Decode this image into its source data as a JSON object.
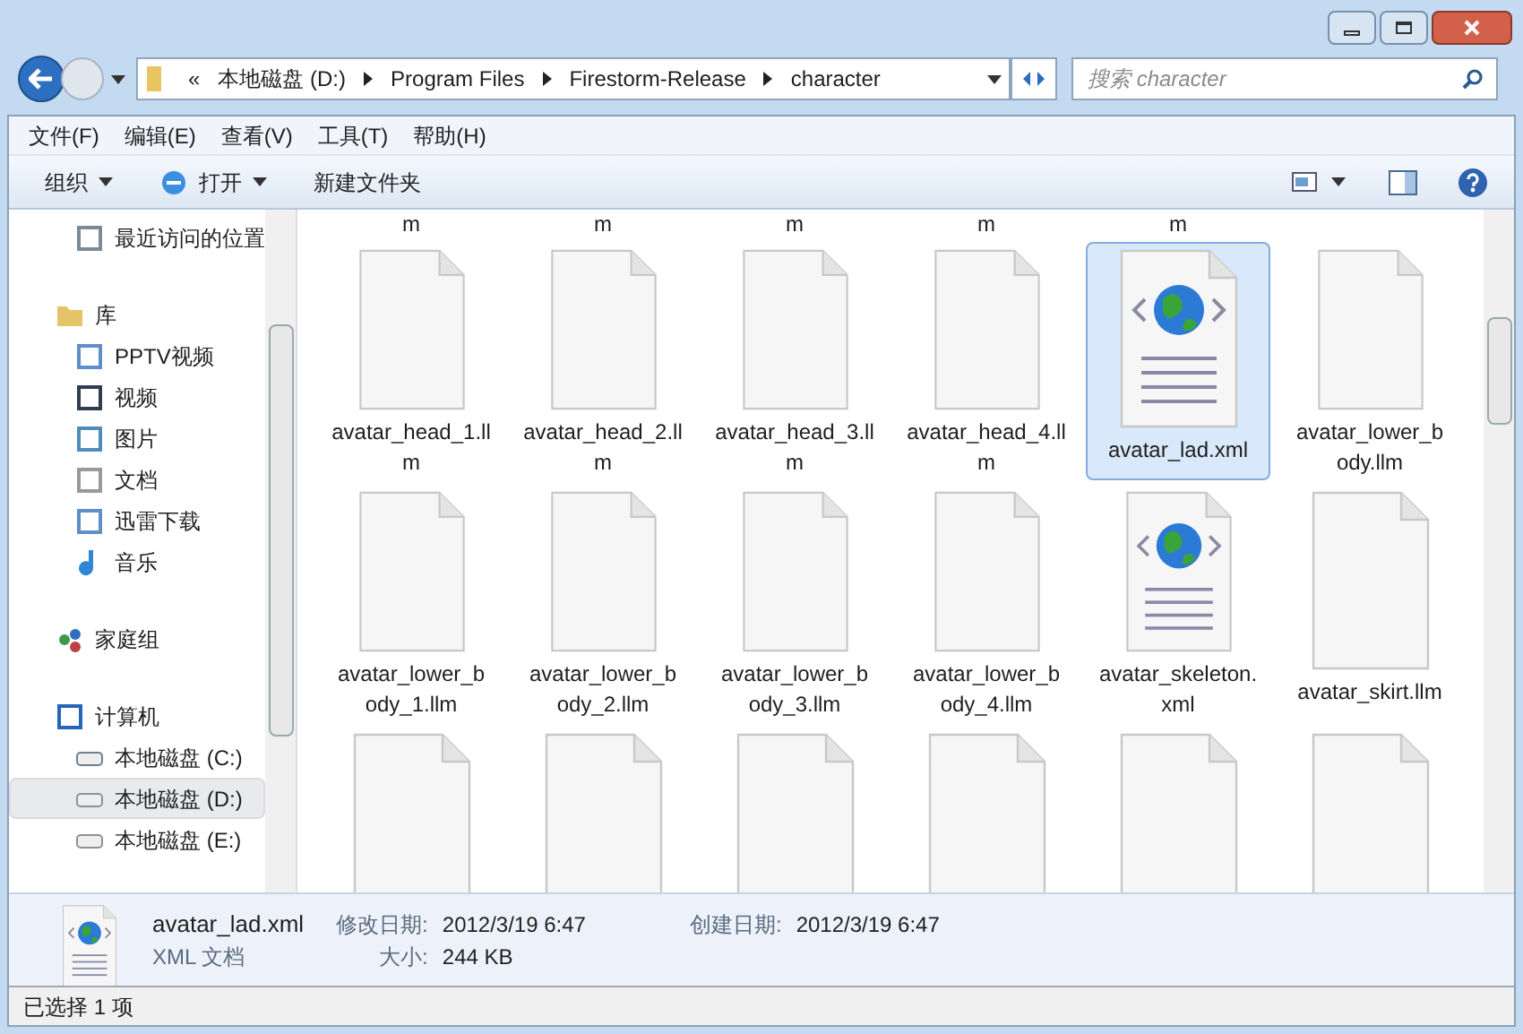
{
  "address": {
    "overflow": "«",
    "path": [
      "本地磁盘 (D:)",
      "Program Files",
      "Firestorm-Release",
      "character"
    ]
  },
  "search": {
    "placeholder": "搜索 character"
  },
  "menu": [
    "文件(F)",
    "编辑(E)",
    "查看(V)",
    "工具(T)",
    "帮助(H)"
  ],
  "toolbar": [
    {
      "label": "组织",
      "kind": "plain",
      "dropdown": true
    },
    {
      "label": "打开",
      "kind": "open",
      "dropdown": true
    },
    {
      "label": "新建文件夹",
      "kind": "plain",
      "dropdown": false
    }
  ],
  "nav": [
    {
      "children": [
        {
          "label": "最近访问的位置",
          "kind": "recent",
          "selected": false
        }
      ]
    },
    {
      "label": "库",
      "kind": "library",
      "selected": false,
      "children": [
        {
          "label": "PPTV视频",
          "kind": "doc",
          "selected": false
        },
        {
          "label": "视频",
          "kind": "video",
          "selected": false
        },
        {
          "label": "图片",
          "kind": "picture",
          "selected": false
        },
        {
          "label": "文档",
          "kind": "text",
          "selected": false
        },
        {
          "label": "迅雷下载",
          "kind": "doc",
          "selected": false
        },
        {
          "label": "音乐",
          "kind": "music",
          "selected": false
        }
      ]
    },
    {
      "label": "家庭组",
      "kind": "homegroup",
      "selected": false
    },
    {
      "label": "计算机",
      "kind": "computer",
      "selected": false,
      "children": [
        {
          "label": "本地磁盘 (C:)",
          "kind": "sysdrive",
          "selected": false
        },
        {
          "label": "本地磁盘 (D:)",
          "kind": "drive",
          "selected": true
        },
        {
          "label": "本地磁盘 (E:)",
          "kind": "drive",
          "selected": false
        }
      ]
    }
  ],
  "cut_row": [
    "m",
    "m",
    "m",
    "m",
    "m"
  ],
  "files": [
    {
      "kind": "generic",
      "lines": [
        "avatar_head_1.ll",
        "m"
      ],
      "selected": false
    },
    {
      "kind": "generic",
      "lines": [
        "avatar_head_2.ll",
        "m"
      ],
      "selected": false
    },
    {
      "kind": "generic",
      "lines": [
        "avatar_head_3.ll",
        "m"
      ],
      "selected": false
    },
    {
      "kind": "generic",
      "lines": [
        "avatar_head_4.ll",
        "m"
      ],
      "selected": false
    },
    {
      "kind": "xml",
      "lines": [
        "avatar_lad.xml"
      ],
      "selected": true
    },
    {
      "kind": "generic",
      "lines": [
        "avatar_lower_b",
        "ody.llm"
      ],
      "selected": false
    },
    {
      "kind": "generic",
      "lines": [
        "avatar_lower_b",
        "ody_1.llm"
      ],
      "selected": false
    },
    {
      "kind": "generic",
      "lines": [
        "avatar_lower_b",
        "ody_2.llm"
      ],
      "selected": false
    },
    {
      "kind": "generic",
      "lines": [
        "avatar_lower_b",
        "ody_3.llm"
      ],
      "selected": false
    },
    {
      "kind": "generic",
      "lines": [
        "avatar_lower_b",
        "ody_4.llm"
      ],
      "selected": false
    },
    {
      "kind": "xml",
      "lines": [
        "avatar_skeleton.",
        "xml"
      ],
      "selected": false
    },
    {
      "kind": "generic",
      "lines": [
        "avatar_skirt.llm"
      ],
      "selected": false
    },
    {
      "kind": "generic",
      "selected": false
    },
    {
      "kind": "generic",
      "selected": false
    },
    {
      "kind": "generic",
      "selected": false
    },
    {
      "kind": "generic",
      "selected": false
    },
    {
      "kind": "generic",
      "selected": false
    },
    {
      "kind": "generic",
      "selected": false
    }
  ],
  "details": {
    "name": "avatar_lad.xml",
    "type": "XML 文档",
    "modified_label": "修改日期:",
    "modified": "2012/3/19 6:47",
    "size_label": "大小:",
    "size": "244 KB",
    "created_label": "创建日期:",
    "created": "2012/3/19 6:47"
  },
  "status_bar": "已选择 1 项"
}
